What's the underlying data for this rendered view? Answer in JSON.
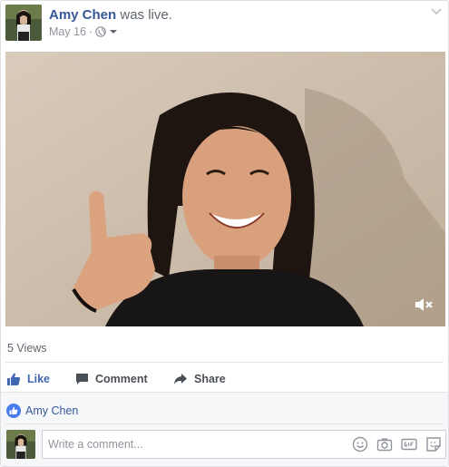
{
  "post": {
    "author": "Amy Chen",
    "action": "was live.",
    "date": "May 16",
    "separator": "·",
    "privacy_icon": "globe-icon",
    "menu_icon": "chevron-down-icon"
  },
  "video": {
    "mute_icon": "speaker-muted-icon"
  },
  "stats": {
    "views": "5 Views"
  },
  "actions": {
    "like_label": "Like",
    "comment_label": "Comment",
    "share_label": "Share"
  },
  "reactions": {
    "liker": "Amy Chen",
    "icon": "like-reaction-icon"
  },
  "comment_box": {
    "placeholder": "Write a comment...",
    "icons": [
      "emoji-icon",
      "camera-icon",
      "gif-icon",
      "sticker-icon"
    ]
  },
  "colors": {
    "link_blue": "#365899",
    "like_blue": "#4267b2",
    "meta_gray": "#90949c"
  }
}
